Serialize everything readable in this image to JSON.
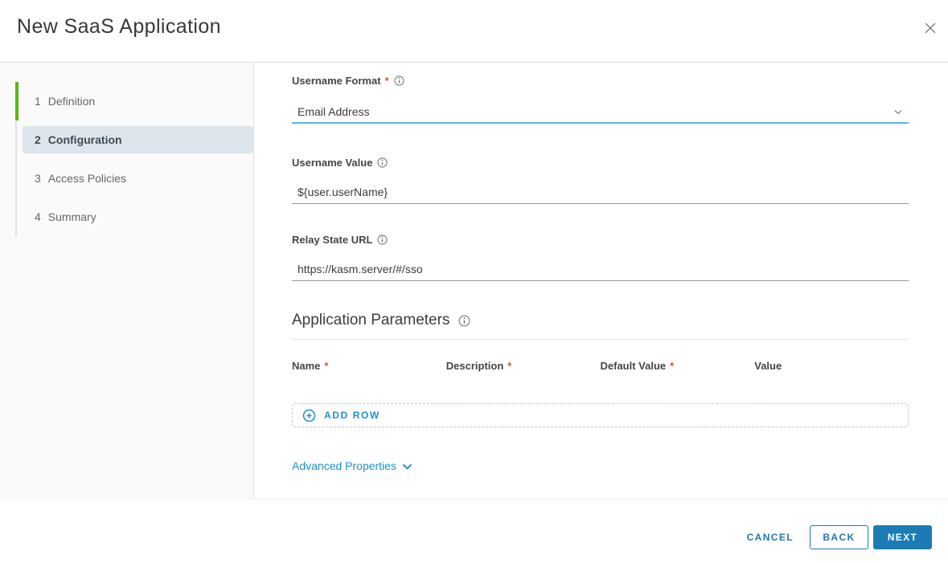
{
  "dialog": {
    "title": "New SaaS Application"
  },
  "ui": {
    "required_marker": "*"
  },
  "icons": {
    "close": "✕",
    "info": "ⓘ",
    "chevron_down": "⌄",
    "plus_circle": "⊕"
  },
  "colors": {
    "accent_blue": "#2190cf",
    "button_blue": "#1b7cb5",
    "select_underline_blue": "#57b6e0",
    "step_complete_green": "#5cb615",
    "active_step_bg": "#dde6ed",
    "required_red": "#dd5242"
  },
  "wizard": {
    "steps": [
      {
        "number": "1",
        "label": "Definition",
        "state": "complete"
      },
      {
        "number": "2",
        "label": "Configuration",
        "state": "current"
      },
      {
        "number": "3",
        "label": "Access Policies",
        "state": "upcoming"
      },
      {
        "number": "4",
        "label": "Summary",
        "state": "upcoming"
      }
    ]
  },
  "form": {
    "username_format": {
      "label": "Username Format",
      "required": true,
      "value": "Email Address"
    },
    "username_value": {
      "label": "Username Value",
      "required": false,
      "value": "${user.userName}"
    },
    "relay_state_url": {
      "label": "Relay State URL",
      "required": false,
      "value": "https://kasm.server/#/sso"
    },
    "application_parameters": {
      "heading": "Application Parameters",
      "columns": [
        {
          "label": "Name",
          "required": true
        },
        {
          "label": "Description",
          "required": true
        },
        {
          "label": "Default Value",
          "required": true
        },
        {
          "label": "Value",
          "required": false
        }
      ],
      "add_row_label": "ADD ROW"
    },
    "advanced_properties_label": "Advanced Properties"
  },
  "footer": {
    "cancel_label": "CANCEL",
    "back_label": "BACK",
    "next_label": "NEXT"
  }
}
